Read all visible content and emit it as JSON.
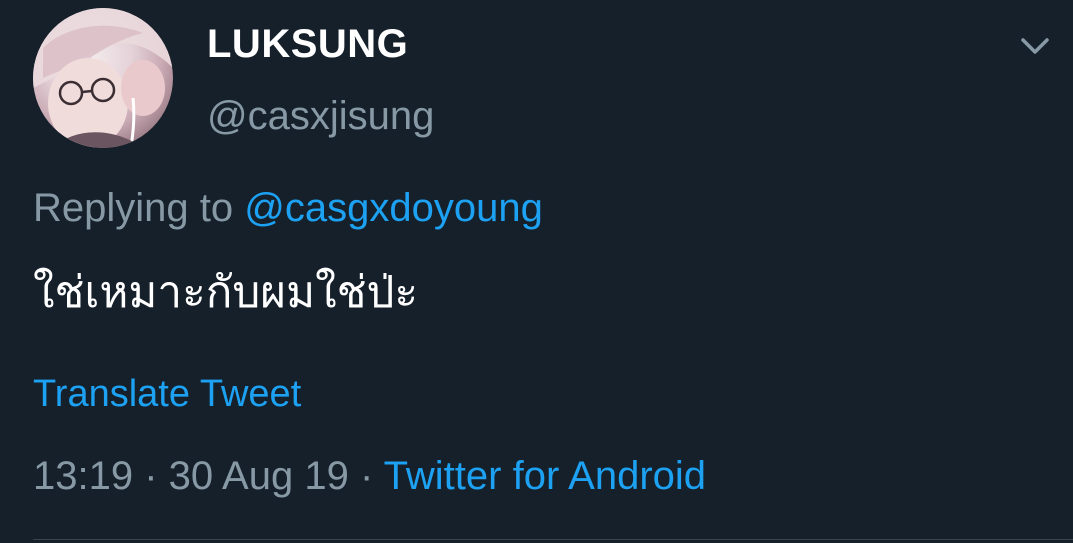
{
  "tweet": {
    "display_name": "LUKSUNG",
    "handle": "@casxjisung",
    "replying_prefix": "Replying to ",
    "replying_to": "@casgxdoyoung",
    "text": "ใช่เหมาะกับผมใช่ป่ะ",
    "translate_label": "Translate Tweet",
    "time": "13:19",
    "separator": " · ",
    "date": "30 Aug 19",
    "source": "Twitter for Android"
  },
  "icons": {
    "menu": "chevron-down-icon",
    "avatar": "profile-photo"
  },
  "colors": {
    "background": "#15202b",
    "primary_text": "#ffffff",
    "secondary_text": "#8899a6",
    "accent": "#1da1f2"
  }
}
